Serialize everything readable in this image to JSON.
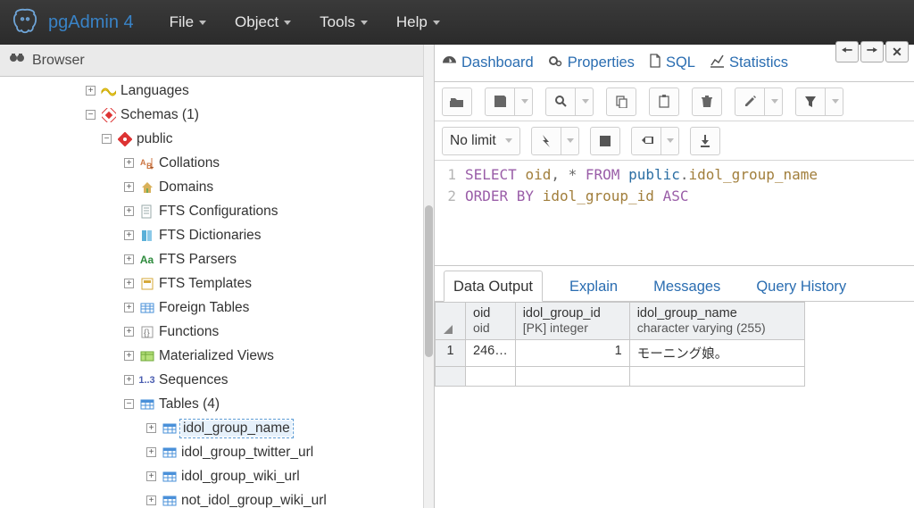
{
  "app": {
    "name": "pgAdmin 4"
  },
  "menubar": {
    "items": [
      "File",
      "Object",
      "Tools",
      "Help"
    ]
  },
  "browser": {
    "title": "Browser",
    "tree": {
      "languages": "Languages",
      "schemas": "Schemas (1)",
      "public": "public",
      "collations": "Collations",
      "domains": "Domains",
      "fts_configs": "FTS Configurations",
      "fts_dicts": "FTS Dictionaries",
      "fts_parsers": "FTS Parsers",
      "fts_templates": "FTS Templates",
      "foreign_tables": "Foreign Tables",
      "functions": "Functions",
      "mat_views": "Materialized Views",
      "sequences": "Sequences",
      "tables": "Tables (4)",
      "table_items": [
        "idol_group_name",
        "idol_group_twitter_url",
        "idol_group_wiki_url",
        "not_idol_group_wiki_url"
      ]
    }
  },
  "tabs": {
    "dashboard": "Dashboard",
    "properties": "Properties",
    "sql": "SQL",
    "statistics": "Statistics"
  },
  "toolbar2": {
    "limit": "No limit"
  },
  "sql": {
    "line1": "SELECT oid, * FROM public.idol_group_name",
    "line2": "ORDER BY idol_group_id ASC"
  },
  "output": {
    "tabs": {
      "data": "Data Output",
      "explain": "Explain",
      "messages": "Messages",
      "history": "Query History"
    },
    "columns": [
      {
        "name": "oid",
        "type": "oid"
      },
      {
        "name": "idol_group_id",
        "type": "[PK] integer"
      },
      {
        "name": "idol_group_name",
        "type": "character varying (255)"
      }
    ],
    "rows": [
      {
        "n": "1",
        "oid": "246…",
        "idol_group_id": "1",
        "idol_group_name": "モーニング娘。"
      }
    ]
  }
}
